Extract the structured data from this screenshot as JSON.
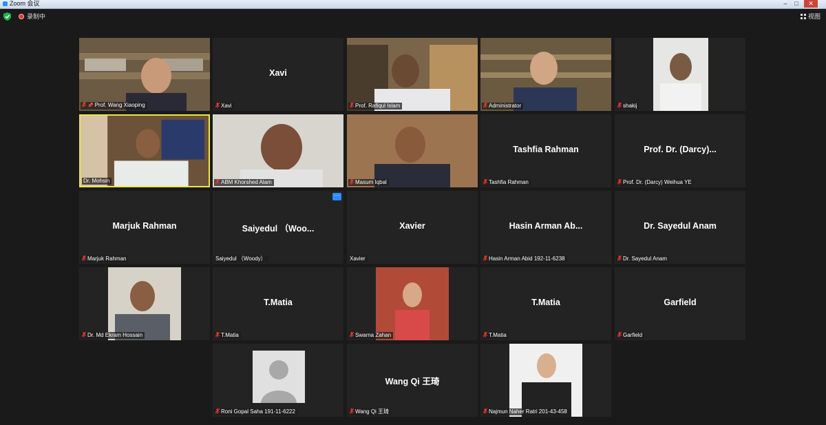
{
  "window": {
    "title": "Zoom 会议",
    "recording_label": "录制中",
    "view_label": "视图"
  },
  "tiles": [
    {
      "label": "Prof. Wang Xiaoping",
      "display": "",
      "pinned": true
    },
    {
      "label": "Xavi",
      "display": "Xavi"
    },
    {
      "label": "Prof. Rafiqul Islam",
      "display": ""
    },
    {
      "label": "Administrator",
      "display": ""
    },
    {
      "label": "shakij",
      "display": ""
    },
    {
      "label": "Dr. Mohsin",
      "display": "",
      "active": true
    },
    {
      "label": "ABM Khorshed Alam",
      "display": ""
    },
    {
      "label": "Masum Iqbal",
      "display": ""
    },
    {
      "label": "Tashfia Rahman",
      "display": "Tashfia Rahman"
    },
    {
      "label": "Prof. Dr. (Darcy) Weihua YE",
      "display": "Prof. Dr. (Darcy)..."
    },
    {
      "label": "Marjuk Rahman",
      "display": "Marjuk Rahman"
    },
    {
      "label": "Saiyedul （Woody）",
      "display": "Saiyedul （Woo...",
      "more_button": "···"
    },
    {
      "label": "Xavier",
      "display": "Xavier"
    },
    {
      "label": "Hasin Arman Abid 192-11-6238",
      "display": "Hasin Arman Ab..."
    },
    {
      "label": "Dr. Sayedul Anam",
      "display": "Dr. Sayedul Anam"
    },
    {
      "label": "Dr. Md Ekram Hossain",
      "display": ""
    },
    {
      "label": "T.Matia",
      "display": "T.Matia"
    },
    {
      "label": "Swarna Zahan",
      "display": ""
    },
    {
      "label": "T.Matia",
      "display": "T.Matia"
    },
    {
      "label": "Garfield",
      "display": "Garfield"
    },
    {
      "label": "Roni Gopal Saha 191-11-6222",
      "display": ""
    },
    {
      "label": "Wang Qi 王琦",
      "display": "Wang Qi 王琦"
    },
    {
      "label": "Najmun Naher Ratri 201-43-458",
      "display": ""
    }
  ],
  "colors": {
    "background": "#1a1a1a",
    "tile": "#232323",
    "active_speaker_border": "#e8e84a",
    "muted_mic": "#e0382e",
    "accent": "#2d8cff"
  }
}
